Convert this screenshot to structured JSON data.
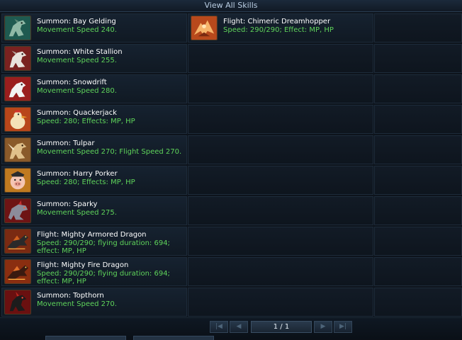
{
  "window": {
    "title": "View All Skills"
  },
  "skills": [
    {
      "name": "Summon: Bay Gelding",
      "desc": "Movement Speed 240.",
      "icon": "horse-icon",
      "accent": "#3f8f7a"
    },
    {
      "name": "Flight: Chimeric Dreamhopper",
      "desc": "Speed: 290/290; Effect: MP, HP",
      "icon": "dreamhopper-icon",
      "accent": "#e07a2a"
    },
    {
      "name": "Summon: White Stallion",
      "desc": "Movement Speed 255.",
      "icon": "stallion-icon",
      "accent": "#b8463e"
    },
    {
      "name": "Summon: Snowdrift",
      "desc": "Movement Speed 280.",
      "icon": "snowdrift-icon",
      "accent": "#c23232"
    },
    {
      "name": "Summon: Quackerjack",
      "desc": "Speed: 280; Effects: MP, HP",
      "icon": "duck-icon",
      "accent": "#d9742a"
    },
    {
      "name": "Summon: Tulpar",
      "desc": "Movement Speed 270; Flight Speed 270.",
      "icon": "tulpar-icon",
      "accent": "#c48a3e"
    },
    {
      "name": "Summon: Harry Porker",
      "desc": "Speed: 280; Effects: MP, HP",
      "icon": "pig-icon",
      "accent": "#e0a23a"
    },
    {
      "name": "Summon: Sparky",
      "desc": "Movement Speed 275.",
      "icon": "sparky-icon",
      "accent": "#b23434"
    },
    {
      "name": "Flight: Mighty Armored Dragon",
      "desc": "Speed: 290/290; flying duration: 694; effect: MP, HP",
      "icon": "armored-dragon-icon",
      "accent": "#c25a24"
    },
    {
      "name": "Flight: Mighty Fire Dragon",
      "desc": "Speed: 290/290; flying duration: 694; effect: MP, HP",
      "icon": "fire-dragon-icon",
      "accent": "#c24e1e"
    },
    {
      "name": "Summon: Topthorn",
      "desc": "Movement Speed 270.",
      "icon": "topthorn-icon",
      "accent": "#a82a22"
    }
  ],
  "desc_lines": {
    "armored": [
      "Speed: 290/290; flying duration: 694;",
      "effect: MP, HP"
    ],
    "fire": [
      "Speed: 290/290; flying duration: 694;",
      "effect: MP, HP"
    ]
  },
  "pager": {
    "page_text": "1 / 1",
    "first_icon": "first-page-icon",
    "prev_icon": "prev-page-icon",
    "next_icon": "next-page-icon",
    "last_icon": "last-page-icon"
  }
}
